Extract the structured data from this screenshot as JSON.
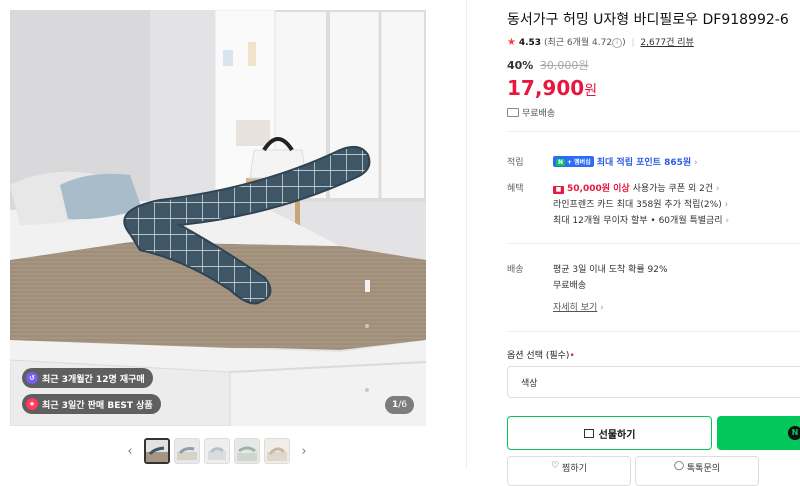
{
  "product": {
    "title": "동서가구 허밍 U자형 바디필로우 DF918992-6",
    "rating": {
      "score": "4.53",
      "recent": "(최근 6개월 4.72",
      "recent_close": ")",
      "reviews": "2,677건 리뷰"
    },
    "discount_rate": "40%",
    "original_price": "30,000원",
    "price": "17,900",
    "price_unit": "원",
    "shipping_label": "무료배송"
  },
  "image": {
    "badges": [
      "최근 3개월간 12명 재구매",
      "최근 3일간 판매 BEST 상품"
    ],
    "counter_current": "1",
    "counter_total": "/6"
  },
  "gallery": {
    "prev": "‹",
    "next": "›",
    "thumb_count": 5,
    "active_index": 0
  },
  "benefits": {
    "points_label": "적립",
    "points_badge_n": "N",
    "points_badge_plus": "+",
    "points_badge_text": "멤버십",
    "points_text": "최대 적립 포인트 865원",
    "perks_label": "혜택",
    "coupon_icon": "■",
    "coupon_amount": "50,000원 이상",
    "coupon_text": " 사용가능 쿠폰 외 2건",
    "card_text": "라인프렌즈 카드 최대 358원 추가 적립(2%)",
    "installment_text": "최대 12개월 무이자 할부 • 60개월 특별금리"
  },
  "delivery": {
    "label": "배송",
    "arrival": "평균 3일 이내 도착 확률 92%",
    "fee": "무료배송",
    "detail_link": "자세히 보기"
  },
  "options": {
    "label": "옵션 선택 (필수)",
    "required_mark": "•",
    "select_placeholder": "색상"
  },
  "actions": {
    "gift_label": "선물하기",
    "buy_logo": "N",
    "wish_label": "찜하기",
    "talk_label": "톡톡문의"
  },
  "colors": {
    "price_red": "#e8173f",
    "naver_green": "#03c75a",
    "benefit_blue": "#2f5ee4"
  }
}
